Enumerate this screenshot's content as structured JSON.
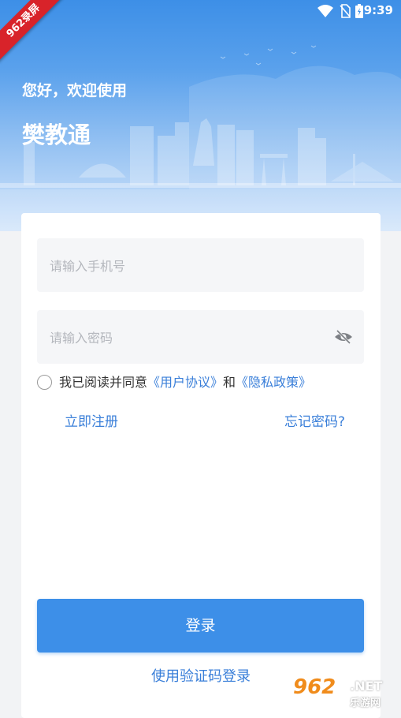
{
  "status_bar": {
    "time": "9:39",
    "icons": [
      "wifi-icon",
      "no-sim-icon",
      "battery-icon"
    ]
  },
  "ribbon": {
    "text": "962录屏"
  },
  "header": {
    "greeting": "您好，欢迎使用",
    "app_title": "樊教通"
  },
  "form": {
    "phone_placeholder": "请输入手机号",
    "password_placeholder": "请输入密码",
    "password_toggle_icon": "eye-off-icon",
    "agree_prefix": "我已阅读并同意",
    "user_agreement": "《用户协议》",
    "agree_and": "和",
    "privacy_policy": "《隐私政策》",
    "register_label": "立即注册",
    "forgot_label": "忘记密码?",
    "login_label": "登录",
    "code_login_label": "使用验证码登录"
  },
  "watermark": {
    "number": "962",
    "net": ".NET",
    "cn": "乐游网"
  },
  "colors": {
    "accent": "#3d8fe8",
    "link": "#3a7fd9",
    "header_top": "#3d8fe7"
  }
}
